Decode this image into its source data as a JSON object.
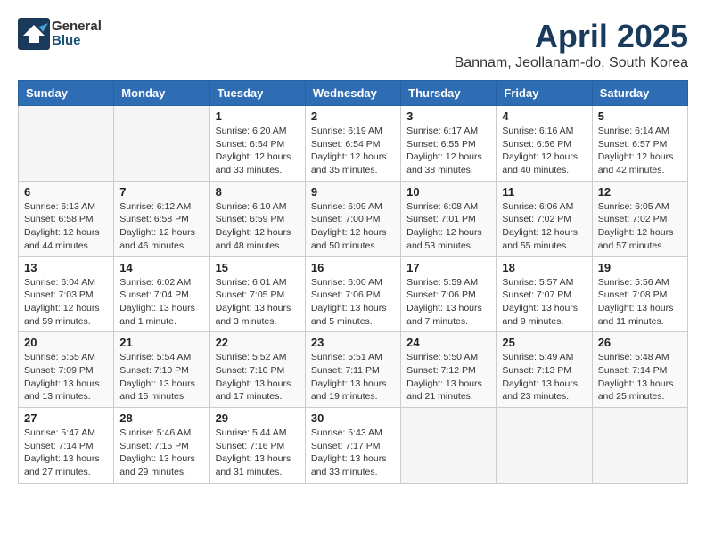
{
  "header": {
    "logo_general": "General",
    "logo_blue": "Blue",
    "month_title": "April 2025",
    "location": "Bannam, Jeollanam-do, South Korea"
  },
  "weekdays": [
    "Sunday",
    "Monday",
    "Tuesday",
    "Wednesday",
    "Thursday",
    "Friday",
    "Saturday"
  ],
  "weeks": [
    [
      {
        "day": "",
        "info": ""
      },
      {
        "day": "",
        "info": ""
      },
      {
        "day": "1",
        "info": "Sunrise: 6:20 AM\nSunset: 6:54 PM\nDaylight: 12 hours\nand 33 minutes."
      },
      {
        "day": "2",
        "info": "Sunrise: 6:19 AM\nSunset: 6:54 PM\nDaylight: 12 hours\nand 35 minutes."
      },
      {
        "day": "3",
        "info": "Sunrise: 6:17 AM\nSunset: 6:55 PM\nDaylight: 12 hours\nand 38 minutes."
      },
      {
        "day": "4",
        "info": "Sunrise: 6:16 AM\nSunset: 6:56 PM\nDaylight: 12 hours\nand 40 minutes."
      },
      {
        "day": "5",
        "info": "Sunrise: 6:14 AM\nSunset: 6:57 PM\nDaylight: 12 hours\nand 42 minutes."
      }
    ],
    [
      {
        "day": "6",
        "info": "Sunrise: 6:13 AM\nSunset: 6:58 PM\nDaylight: 12 hours\nand 44 minutes."
      },
      {
        "day": "7",
        "info": "Sunrise: 6:12 AM\nSunset: 6:58 PM\nDaylight: 12 hours\nand 46 minutes."
      },
      {
        "day": "8",
        "info": "Sunrise: 6:10 AM\nSunset: 6:59 PM\nDaylight: 12 hours\nand 48 minutes."
      },
      {
        "day": "9",
        "info": "Sunrise: 6:09 AM\nSunset: 7:00 PM\nDaylight: 12 hours\nand 50 minutes."
      },
      {
        "day": "10",
        "info": "Sunrise: 6:08 AM\nSunset: 7:01 PM\nDaylight: 12 hours\nand 53 minutes."
      },
      {
        "day": "11",
        "info": "Sunrise: 6:06 AM\nSunset: 7:02 PM\nDaylight: 12 hours\nand 55 minutes."
      },
      {
        "day": "12",
        "info": "Sunrise: 6:05 AM\nSunset: 7:02 PM\nDaylight: 12 hours\nand 57 minutes."
      }
    ],
    [
      {
        "day": "13",
        "info": "Sunrise: 6:04 AM\nSunset: 7:03 PM\nDaylight: 12 hours\nand 59 minutes."
      },
      {
        "day": "14",
        "info": "Sunrise: 6:02 AM\nSunset: 7:04 PM\nDaylight: 13 hours\nand 1 minute."
      },
      {
        "day": "15",
        "info": "Sunrise: 6:01 AM\nSunset: 7:05 PM\nDaylight: 13 hours\nand 3 minutes."
      },
      {
        "day": "16",
        "info": "Sunrise: 6:00 AM\nSunset: 7:06 PM\nDaylight: 13 hours\nand 5 minutes."
      },
      {
        "day": "17",
        "info": "Sunrise: 5:59 AM\nSunset: 7:06 PM\nDaylight: 13 hours\nand 7 minutes."
      },
      {
        "day": "18",
        "info": "Sunrise: 5:57 AM\nSunset: 7:07 PM\nDaylight: 13 hours\nand 9 minutes."
      },
      {
        "day": "19",
        "info": "Sunrise: 5:56 AM\nSunset: 7:08 PM\nDaylight: 13 hours\nand 11 minutes."
      }
    ],
    [
      {
        "day": "20",
        "info": "Sunrise: 5:55 AM\nSunset: 7:09 PM\nDaylight: 13 hours\nand 13 minutes."
      },
      {
        "day": "21",
        "info": "Sunrise: 5:54 AM\nSunset: 7:10 PM\nDaylight: 13 hours\nand 15 minutes."
      },
      {
        "day": "22",
        "info": "Sunrise: 5:52 AM\nSunset: 7:10 PM\nDaylight: 13 hours\nand 17 minutes."
      },
      {
        "day": "23",
        "info": "Sunrise: 5:51 AM\nSunset: 7:11 PM\nDaylight: 13 hours\nand 19 minutes."
      },
      {
        "day": "24",
        "info": "Sunrise: 5:50 AM\nSunset: 7:12 PM\nDaylight: 13 hours\nand 21 minutes."
      },
      {
        "day": "25",
        "info": "Sunrise: 5:49 AM\nSunset: 7:13 PM\nDaylight: 13 hours\nand 23 minutes."
      },
      {
        "day": "26",
        "info": "Sunrise: 5:48 AM\nSunset: 7:14 PM\nDaylight: 13 hours\nand 25 minutes."
      }
    ],
    [
      {
        "day": "27",
        "info": "Sunrise: 5:47 AM\nSunset: 7:14 PM\nDaylight: 13 hours\nand 27 minutes."
      },
      {
        "day": "28",
        "info": "Sunrise: 5:46 AM\nSunset: 7:15 PM\nDaylight: 13 hours\nand 29 minutes."
      },
      {
        "day": "29",
        "info": "Sunrise: 5:44 AM\nSunset: 7:16 PM\nDaylight: 13 hours\nand 31 minutes."
      },
      {
        "day": "30",
        "info": "Sunrise: 5:43 AM\nSunset: 7:17 PM\nDaylight: 13 hours\nand 33 minutes."
      },
      {
        "day": "",
        "info": ""
      },
      {
        "day": "",
        "info": ""
      },
      {
        "day": "",
        "info": ""
      }
    ]
  ]
}
